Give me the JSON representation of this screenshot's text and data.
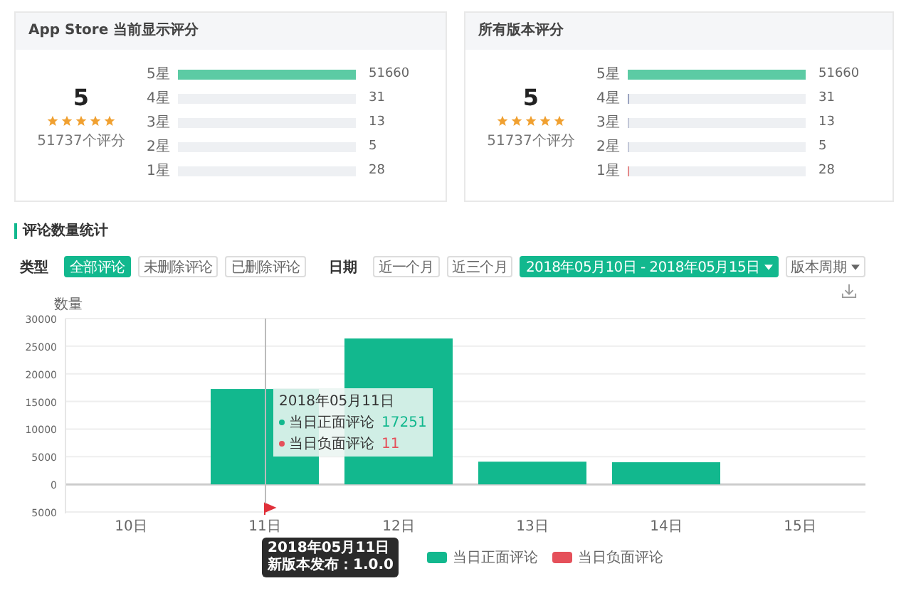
{
  "rating_cards": [
    {
      "title": "App Store 当前显示评分",
      "score": "5",
      "stars": 5,
      "count_label": "51737个评分",
      "rows": [
        {
          "label": "5星",
          "level": 0.9985,
          "count": "51660"
        },
        {
          "label": "4星",
          "level": 0.0006,
          "count": "31"
        },
        {
          "label": "3星",
          "level": 0.0003,
          "count": "13"
        },
        {
          "label": "2星",
          "level": 0.0001,
          "count": "5"
        },
        {
          "label": "1星",
          "level": 0.0005,
          "count": "28"
        }
      ]
    },
    {
      "title": "所有版本评分",
      "score": "5",
      "stars": 5,
      "count_label": "51737个评分",
      "rows": [
        {
          "label": "5星",
          "level": 0.9985,
          "count": "51660",
          "color": "#5ccba4"
        },
        {
          "label": "4星",
          "level": 0.006,
          "count": "31",
          "color": "#9aa3c0"
        },
        {
          "label": "3星",
          "level": 0.006,
          "count": "13",
          "color": "#c3c8d8"
        },
        {
          "label": "2星",
          "level": 0.006,
          "count": "5",
          "color": "#c3c8d8"
        },
        {
          "label": "1星",
          "level": 0.006,
          "count": "28",
          "color": "#e58a8a"
        }
      ]
    }
  ],
  "section_title": "评论数量统计",
  "filters": [
    {
      "label": "类型",
      "options": [
        {
          "text": "全部评论",
          "selected": true,
          "dropdown": false
        },
        {
          "text": "未删除评论",
          "selected": false,
          "dropdown": false
        },
        {
          "text": "已删除评论",
          "selected": false,
          "dropdown": false
        }
      ]
    },
    {
      "label": "日期",
      "options": [
        {
          "text": "近一个月",
          "selected": false,
          "dropdown": false
        },
        {
          "text": "近三个月",
          "selected": false,
          "dropdown": false
        },
        {
          "text": "2018年05月10日 - 2018年05月15日",
          "selected": true,
          "dropdown": true
        },
        {
          "text": "版本周期",
          "selected": false,
          "dropdown": true
        }
      ]
    }
  ],
  "chart": {
    "chart_data": {
      "type": "bar",
      "ylabel": "数量",
      "grid": true,
      "categories": [
        "10日",
        "11日",
        "12日",
        "13日",
        "14日",
        "15日"
      ],
      "series": [
        {
          "name": "当日正面评论",
          "color": "#12b88e",
          "values": [
            null,
            17251,
            26400,
            4100,
            4000,
            null
          ]
        },
        {
          "name": "当日负面评论",
          "color": "#e5505a",
          "values": [
            null,
            null,
            null,
            null,
            null,
            null
          ]
        }
      ],
      "ylim": [
        -5000,
        30000
      ],
      "yticks": [
        {
          "value": -5000,
          "label": "5000"
        },
        0,
        5000,
        10000,
        15000,
        20000,
        25000,
        30000
      ]
    },
    "tooltip": {
      "date": "2018年05月11日",
      "rows": [
        {
          "label": "当日正面评论",
          "value": "17251",
          "color": "#12b88e"
        },
        {
          "label": "当日负面评论",
          "value": "11",
          "color": "#e5505a"
        }
      ]
    },
    "release": {
      "date": "2018年05月11日",
      "text": "新版本发布：1.0.0"
    }
  }
}
